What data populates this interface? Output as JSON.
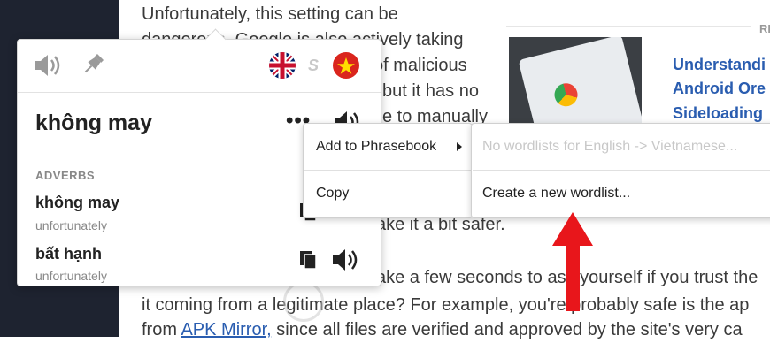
{
  "article": {
    "lines": [
      "Unfortunately, this setting can be",
      "dangerous. Google is also actively taking",
      "of malicious",
      "but it has no",
      "e to manually",
      "ake it a bit safer.",
      "ake a few seconds to ask yourself if you trust the",
      "it coming from a legitimate place? For example, you're probably safe is the ap",
      "since all files are verified and approved by the site's very ca"
    ],
    "line9_prefix": "from ",
    "line9_link": "APK Mirror,",
    "line9_suffix": " since all files are verified and approved by the site's very ca"
  },
  "related": {
    "label": "RE",
    "title_lines": [
      "Understandi",
      "Android Ore",
      "Sideloading"
    ]
  },
  "popup": {
    "main_word": "không may",
    "more_label": "•••",
    "pos_label": "ADVERBS",
    "entries": [
      {
        "word": "không may",
        "sub": "unfortunately"
      },
      {
        "word": "bất hạnh",
        "sub": "unfortunately"
      }
    ],
    "swap_label": "S"
  },
  "menu": {
    "add_to_phrasebook": "Add to Phrasebook",
    "copy": "Copy"
  },
  "submenu": {
    "no_wordlists": "No wordlists for English -> Vietnamese...",
    "create_new": "Create a new wordlist..."
  },
  "colors": {
    "sidebar_dark": "#1e2330",
    "link_blue": "#2a5db0",
    "arrow_red": "#e8161b",
    "vn_red": "#da251d",
    "vn_star": "#ffde00"
  }
}
